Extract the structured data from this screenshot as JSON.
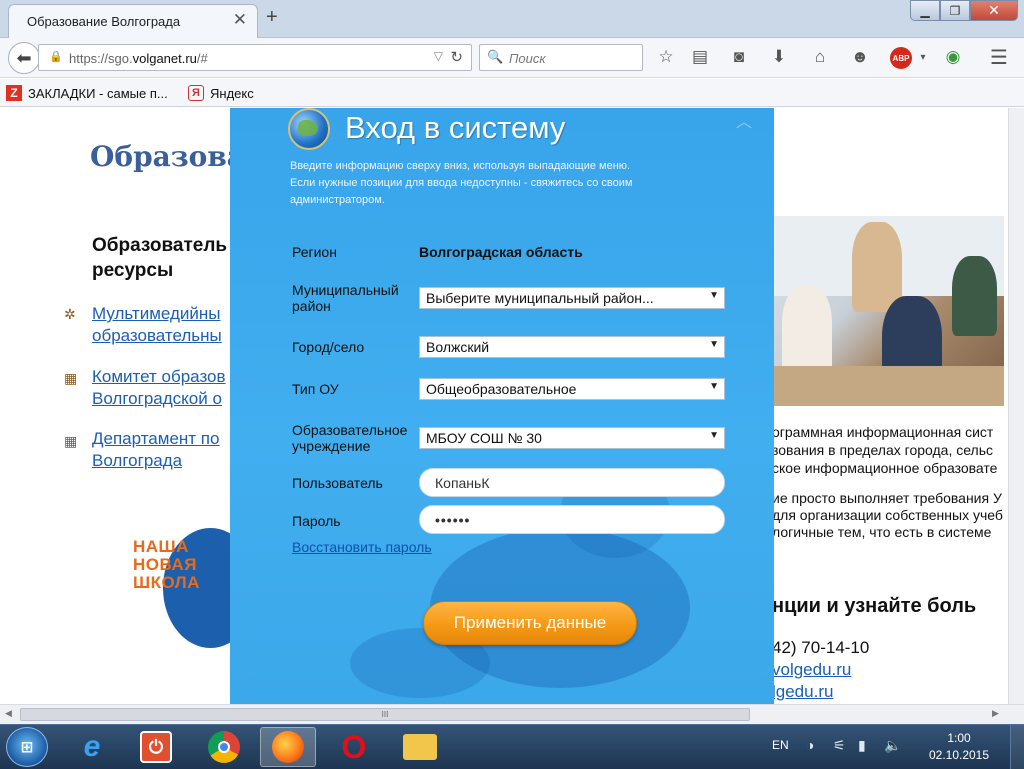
{
  "browser": {
    "tab_title": "Образование Волгограда",
    "url_prefix": "https://sgo.",
    "url_domain": "volganet.ru",
    "url_suffix": "/#",
    "search_placeholder": "Поиск",
    "abp_label": "ABP"
  },
  "bookmarks": [
    {
      "label": "ЗАКЛАДКИ - самые п...",
      "icon": "Z"
    },
    {
      "label": "Яндекс",
      "icon": "Я"
    }
  ],
  "page": {
    "site_title": "Образова",
    "resources_heading_1": "Образователь",
    "resources_heading_2": "ресурсы",
    "links": [
      {
        "line1": "Мультимедийны",
        "line2": "образовательны"
      },
      {
        "line1": "Комитет образов",
        "line2": "Волгоградской о"
      },
      {
        "line1": "Департамент по",
        "line2": "Волгограда"
      }
    ],
    "logo_lines": [
      "НАША",
      "НОВАЯ",
      "ШКОЛА"
    ],
    "side_text": [
      "ограммная информационная сист",
      "зования в пределах города, сельс",
      "ское информационное образовате",
      "ие просто выполняет требования У",
      "для организации собственных учеб",
      "логичные тем, что есть в системе"
    ],
    "side_big": "нции и узнайте боль",
    "side_phone": "42) 70-14-10",
    "side_link_1": "volgedu.ru",
    "side_link_2": "lgedu.ru"
  },
  "login": {
    "title": "Вход в систему",
    "description_1": "Введите информацию сверху вниз, используя выпадающие меню.",
    "description_2": "Если нужные позиции для ввода недоступны - свяжитесь со своим",
    "description_3": "администратором.",
    "region_label": "Регион",
    "region_value": "Волгоградская область",
    "district_label_1": "Муниципальный",
    "district_label_2": "район",
    "district_value": "Выберите муниципальный район...",
    "city_label": "Город/село",
    "city_value": "Волжский",
    "type_label": "Тип ОУ",
    "type_value": "Общеобразовательное",
    "school_label_1": "Образовательное",
    "school_label_2": "учреждение",
    "school_value": "МБОУ СОШ № 30",
    "user_label": "Пользователь",
    "user_value": "КопаньК",
    "password_label": "Пароль",
    "password_value": "••••••",
    "restore_link": "Восстановить пароль",
    "apply_button": "Применить данные"
  },
  "scrollbar": {
    "grip": "III"
  },
  "taskbar": {
    "language": "EN",
    "time": "1:00",
    "date": "02.10.2015",
    "apps": [
      "internet-explorer",
      "power",
      "chrome",
      "firefox",
      "opera",
      "file-explorer"
    ]
  },
  "colors": {
    "modal_bg": "#3ba8ea",
    "apply_button": "#f59a15",
    "link": "#1a5fb4",
    "taskbar": "#1d3552"
  }
}
